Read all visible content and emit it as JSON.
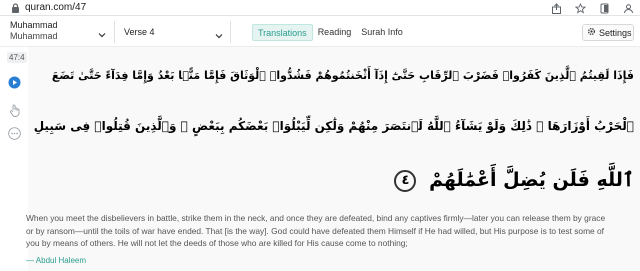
{
  "browser": {
    "url": "quran.com/47"
  },
  "header": {
    "surah_name": "Muhammad",
    "surah_sub": "Muhammad",
    "verse_label": "Verse 4",
    "tabs": [
      {
        "label": "Translations",
        "active": true
      },
      {
        "label": "Reading",
        "active": false
      },
      {
        "label": "Surah Info",
        "active": false
      }
    ],
    "settings_label": "Settings"
  },
  "verse": {
    "key": "47:4",
    "arabic_lines": [
      "فَإِذَا لَقِيتُمُ ٱلَّذِينَ كَفَرُوا۟ فَضَرْبَ ٱلرِّقَابِ حَتَّىٰٓ إِذَآ أَثْخَنتُمُوهُمْ فَشُدُّوا۟ ٱلْوَثَاقَ فَإِمَّا مَنًّۢا بَعْدُ وَإِمَّا فِدَآءً حَتَّىٰ تَضَعَ",
      "ٱلْحَرْبُ أَوْزَارَهَا ۚ ذَٰلِكَ وَلَوْ يَشَآءُ ٱللَّهُ لَٱنتَصَرَ مِنْهُمْ وَلَٰكِن لِّيَبْلُوَا۟ بَعْضَكُم بِبَعْضٍ ۗ وَٱلَّذِينَ قُتِلُوا۟ فِى سَبِيلِ",
      "ٱللَّهِ فَلَن يُضِلَّ أَعْمَٰلَهُمْ"
    ],
    "ayah_number": "٤",
    "translation": "When you meet the disbelievers in battle, strike them in the neck, and once they are defeated, bind any captives firmly—later you can release them by grace or by ransom—until the toils of war have ended. That [is the way]. God could have defeated them Himself if He had willed, but His purpose is to test some of you by means of others. He will not let the deeds of those who are killed for His cause come to nothing;",
    "translator": "— Abdul Haleem"
  },
  "colors": {
    "accent": "#2a9d8f",
    "verse_bg": "#f9f9f9",
    "play": "#2a7fd4"
  },
  "icons": [
    "lock-icon",
    "share-icon",
    "star-icon",
    "tablet-icon",
    "profile-icon",
    "chevron-down-icon",
    "gear-icon",
    "play-icon",
    "hand-icon",
    "more-icon"
  ]
}
